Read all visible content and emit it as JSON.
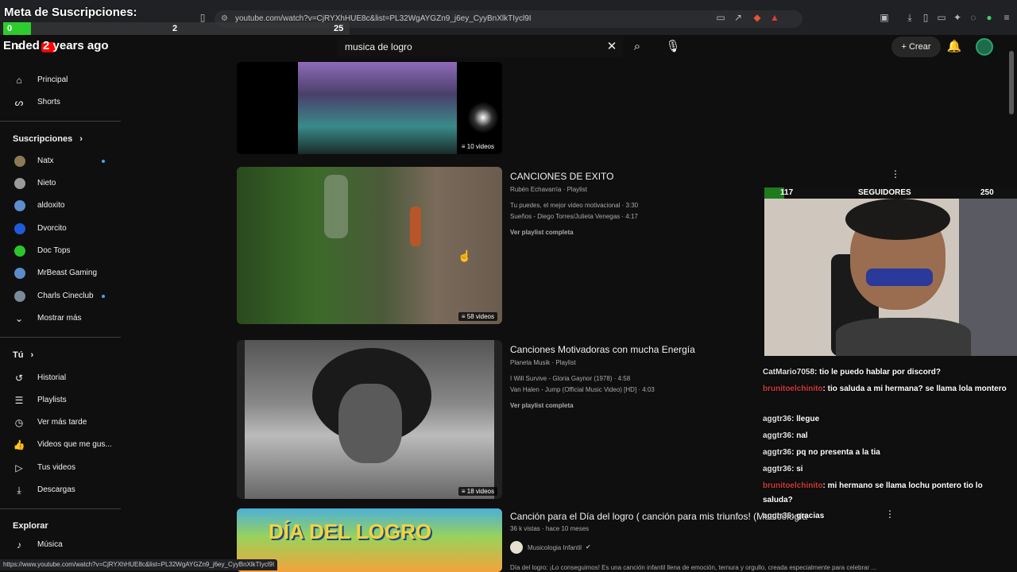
{
  "browser": {
    "url": "youtube.com/watch?v=CjRYXhHUE8c&list=PL32WgAYGZn9_j6ey_CyyBnXlkTIycl9I",
    "status_url": "https://www.youtube.com/watch?v=CjRYXhHUE8c&list=PL32WgAYGZn9_j6ey_CyyBnXlkTIycl9I"
  },
  "overlay": {
    "goal_title": "Meta de Suscripciones:",
    "goal_min": "0",
    "goal_current": "2",
    "goal_max": "25",
    "goal_progress": 0.08,
    "ended_text": "Ended 2 years ago",
    "followers_min": "117",
    "followers_label": "SEGUIDORES",
    "followers_max": "250",
    "followers_progress": 0.08
  },
  "header": {
    "search_value": "musica de logro",
    "create_label": "Crear"
  },
  "sidebar": {
    "main": [
      {
        "label": "Principal",
        "icon": "home-icon"
      },
      {
        "label": "Shorts",
        "icon": "shorts-icon"
      }
    ],
    "subs_title": "Suscripciones",
    "subs": [
      {
        "label": "Natx",
        "color": "#8a7a55",
        "dot": true
      },
      {
        "label": "Nieto",
        "color": "#9a9a9a",
        "dot": false
      },
      {
        "label": "aldoxito",
        "color": "#5a8fd0",
        "dot": false
      },
      {
        "label": "Dvorcito",
        "color": "#1e5bd8",
        "dot": false
      },
      {
        "label": "Doc Tops",
        "color": "#29c729",
        "dot": false
      },
      {
        "label": "MrBeast Gaming",
        "color": "#5b8cc9",
        "dot": false
      },
      {
        "label": "Charls Cineclub",
        "color": "#7a8a9a",
        "dot": true
      },
      {
        "label": "Mostrar más",
        "color": "",
        "dot": false
      }
    ],
    "you_title": "Tú",
    "you": [
      {
        "label": "Historial",
        "icon": "history-icon"
      },
      {
        "label": "Playlists",
        "icon": "playlists-icon"
      },
      {
        "label": "Ver más tarde",
        "icon": "watch-later-icon"
      },
      {
        "label": "Videos que me gus...",
        "icon": "like-icon"
      },
      {
        "label": "Tus videos",
        "icon": "your-videos-icon"
      },
      {
        "label": "Descargas",
        "icon": "downloads-icon"
      }
    ],
    "explore_title": "Explorar",
    "explore": [
      {
        "label": "Música",
        "icon": "music-icon"
      }
    ]
  },
  "results": [
    {
      "badge": "10 videos",
      "title": "",
      "meta": "",
      "lines": [],
      "link": ""
    },
    {
      "badge": "58 videos",
      "title": "CANCIONES DE EXITO",
      "meta": "Rubén Echavarría · Playlist",
      "lines": [
        "Tu puedes, el mejor video motivacional · 3:30",
        "Sueños - Diego Torres/Julieta Venegas · 4:17"
      ],
      "link": "Ver playlist completa"
    },
    {
      "badge": "18 videos",
      "title": "Canciones Motivadoras con mucha Energía",
      "meta": "Planeta Musik · Playlist",
      "lines": [
        "I Will Survive - Gloria Gaynor (1978) · 4:58",
        "Van Halen - Jump (Official Music Video) [HD] · 4:03"
      ],
      "link": "Ver playlist completa"
    },
    {
      "badge": "",
      "title": "Canción para el Día del logro ( canción para mis triunfos! (Musicología",
      "meta": "36 k vistas · hace 10 meses",
      "channel": "Musicologia Infantil",
      "lines": [
        "Día del logro: ¡Lo conseguimos! Es una canción infantil llena de emoción, ternura y orgullo, creada especialmente para celebrar ..."
      ],
      "thumb_text": "DÍA DEL LOGRO",
      "link": ""
    }
  ],
  "chat": [
    {
      "user": "CatMario7058",
      "text": ": tio le puedo hablar por discord?",
      "red": false
    },
    {
      "user": "brunitoelchinito",
      "text": ": tio saluda a mi hermana? se llama lola montero",
      "red": true
    },
    {
      "user": "aggtr36",
      "text": ": llegue",
      "red": false
    },
    {
      "user": "aggtr36",
      "text": ": nal",
      "red": false
    },
    {
      "user": "aggtr36",
      "text": ": pq no presenta a la tia",
      "red": false
    },
    {
      "user": "aggtr36",
      "text": ": si",
      "red": false
    },
    {
      "user": "brunitoelchinito",
      "text": ": mi hermano se llama lochu pontero tio lo saluda?",
      "red": true
    },
    {
      "user": "aggtr36",
      "text": ": gracias",
      "red": false
    }
  ]
}
